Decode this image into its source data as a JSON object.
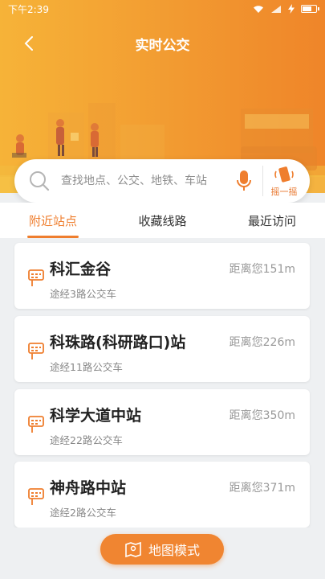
{
  "status_bar": {
    "time": "下午2:39"
  },
  "header": {
    "title": "实时公交"
  },
  "search": {
    "placeholder": "查找地点、公交、地铁、车站",
    "shake_label": "摇一摇"
  },
  "tabs": [
    {
      "label": "附近站点"
    },
    {
      "label": "收藏线路"
    },
    {
      "label": "最近访问"
    }
  ],
  "stops": [
    {
      "name": "科汇金谷",
      "distance": "距离您151m",
      "lines": "途经3路公交车"
    },
    {
      "name": "科珠路(科研路口)站",
      "distance": "距离您226m",
      "lines": "途经11路公交车"
    },
    {
      "name": "科学大道中站",
      "distance": "距离您350m",
      "lines": "途经22路公交车"
    },
    {
      "name": "神舟路中站",
      "distance": "距离您371m",
      "lines": "途经2路公交车"
    }
  ],
  "map_mode": {
    "label": "地图模式"
  },
  "colors": {
    "accent": "#ef7e2e",
    "header_start": "#f6b338",
    "header_end": "#ef8529"
  }
}
